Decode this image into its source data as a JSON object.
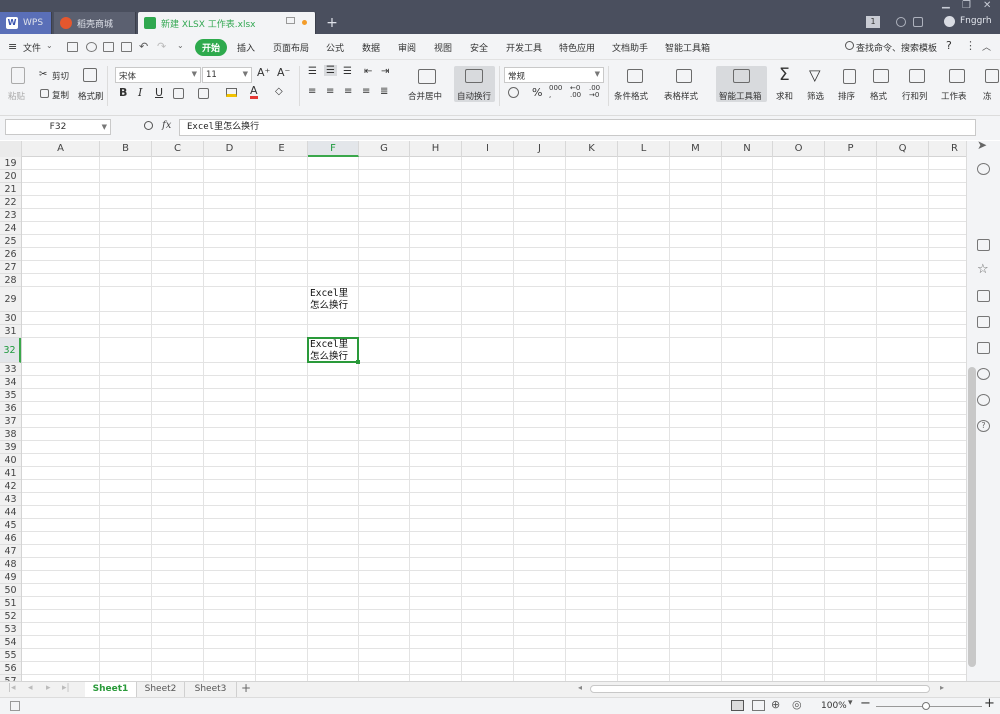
{
  "titlebar": {
    "tabs": [
      {
        "label": "WPS",
        "icon": "wps-logo-icon"
      },
      {
        "label": "稻壳商城",
        "icon": "docer-store-icon"
      },
      {
        "label": "新建 XLSX 工作表.xlsx",
        "icon": "spreadsheet-file-icon"
      }
    ],
    "new_tab_label": "+",
    "badge_count": "1",
    "user_name": "Fnggrh"
  },
  "menubar": {
    "file_label": "文件",
    "items": [
      "开始",
      "插入",
      "页面布局",
      "公式",
      "数据",
      "审阅",
      "视图",
      "安全",
      "开发工具",
      "特色应用",
      "文档助手",
      "智能工具箱"
    ],
    "search_label": "查找命令、搜索模板",
    "help_label": "?"
  },
  "ribbon": {
    "paste_label": "粘贴",
    "cut_label": "剪切",
    "copy_label": "复制",
    "format_painter_label": "格式刷",
    "font_name": "宋体",
    "font_size": "11",
    "bold_label": "B",
    "italic_label": "I",
    "underline_label": "U",
    "merge_center_label": "合并居中",
    "wrap_text_label": "自动换行",
    "number_format": "常规",
    "percent_label": "%",
    "conditional_format_label": "条件格式",
    "table_style_label": "表格样式",
    "smart_toolbox_label": "智能工具箱",
    "sum_label": "求和",
    "filter_label": "筛选",
    "sort_label": "排序",
    "format_label": "格式",
    "row_col_label": "行和列",
    "worksheet_label": "工作表",
    "more_label": "冻"
  },
  "formula": {
    "name_box": "F32",
    "fx_label": "fx",
    "content": "Excel里怎么换行"
  },
  "columns": [
    "A",
    "B",
    "C",
    "D",
    "E",
    "F",
    "G",
    "H",
    "I",
    "J",
    "K",
    "L",
    "M",
    "N",
    "O",
    "P",
    "Q",
    "R"
  ],
  "rows": [
    "19",
    "20",
    "21",
    "22",
    "23",
    "24",
    "25",
    "26",
    "27",
    "28",
    "29",
    "30",
    "31",
    "32",
    "33",
    "34",
    "35",
    "36",
    "37",
    "38",
    "39",
    "40",
    "41",
    "42",
    "43",
    "44",
    "45",
    "46",
    "47",
    "48",
    "49",
    "50",
    "51",
    "52",
    "53",
    "54",
    "55",
    "56",
    "57"
  ],
  "cells": {
    "F29": {
      "line1": "Excel里",
      "line2": "怎么换行"
    },
    "F32": {
      "line1": "Excel里",
      "line2": "怎么换行"
    }
  },
  "sheets": [
    "Sheet1",
    "Sheet2",
    "Sheet3"
  ],
  "add_sheet_label": "+",
  "status": {
    "zoom": "100%"
  },
  "colors": {
    "accent": "#2a9a3a",
    "titlebar": "#4a4f5e",
    "ribbon": "#f3f4f6"
  }
}
